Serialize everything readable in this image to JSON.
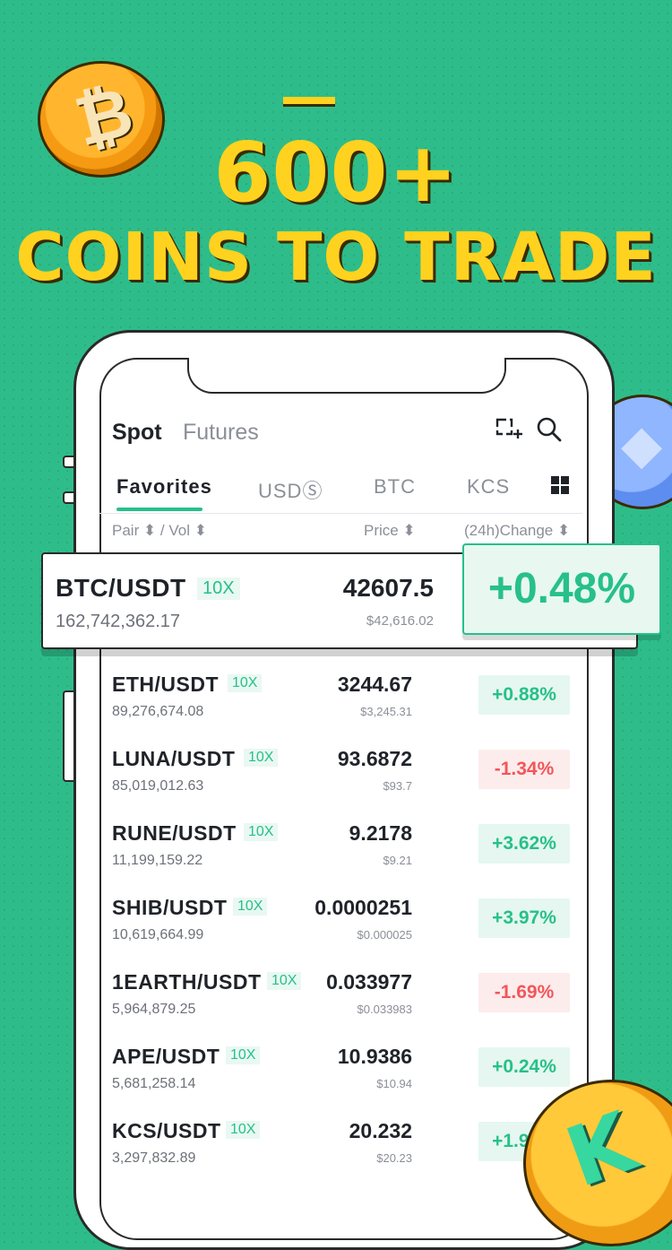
{
  "promo": {
    "headline_line1": "600+",
    "headline_line2": "COINS TO TRADE"
  },
  "coins": {
    "btc_symbol": "₿",
    "eth_symbol": "◆",
    "kcs_symbol": "K"
  },
  "colors": {
    "background": "#2ebd8a",
    "headline": "#ffd21f",
    "up": "#27c08a",
    "down": "#f2565a"
  },
  "app": {
    "top_tabs": [
      "Spot",
      "Futures"
    ],
    "active_top_tab": "Spot",
    "icons": [
      "edit-favorites-icon",
      "search-icon"
    ],
    "market_tabs": [
      "Favorites",
      "USDⓈ",
      "BTC",
      "KCS"
    ],
    "active_market_tab": "Favorites",
    "columns": {
      "pair_vol": "Pair ⬍ / Vol ⬍",
      "price": "Price ⬍",
      "change": "(24h)Change ⬍"
    },
    "highlight": {
      "pair": "BTC/USDT",
      "leverage": "10X",
      "volume": "162,742,362.17",
      "price": "42607.5",
      "price_usd": "$42,616.02",
      "change": "+0.48%"
    },
    "rows": [
      {
        "pair": "ETH/USDT",
        "leverage": "10X",
        "volume": "89,276,674.08",
        "price": "3244.67",
        "price_usd": "$3,245.31",
        "change": "+0.88%",
        "direction": "up"
      },
      {
        "pair": "LUNA/USDT",
        "leverage": "10X",
        "volume": "85,019,012.63",
        "price": "93.6872",
        "price_usd": "$93.7",
        "change": "-1.34%",
        "direction": "down"
      },
      {
        "pair": "RUNE/USDT",
        "leverage": "10X",
        "volume": "11,199,159.22",
        "price": "9.2178",
        "price_usd": "$9.21",
        "change": "+3.62%",
        "direction": "up"
      },
      {
        "pair": "SHIB/USDT",
        "leverage": "10X",
        "volume": "10,619,664.99",
        "price": "0.0000251",
        "price_usd": "$0.000025",
        "change": "+3.97%",
        "direction": "up"
      },
      {
        "pair": "1EARTH/USDT",
        "leverage": "10X",
        "volume": "5,964,879.25",
        "price": "0.033977",
        "price_usd": "$0.033983",
        "change": "-1.69%",
        "direction": "down"
      },
      {
        "pair": "APE/USDT",
        "leverage": "10X",
        "volume": "5,681,258.14",
        "price": "10.9386",
        "price_usd": "$10.94",
        "change": "+0.24%",
        "direction": "up"
      },
      {
        "pair": "KCS/USDT",
        "leverage": "10X",
        "volume": "3,297,832.89",
        "price": "20.232",
        "price_usd": "$20.23",
        "change": "+1.92%",
        "direction": "up"
      }
    ]
  }
}
